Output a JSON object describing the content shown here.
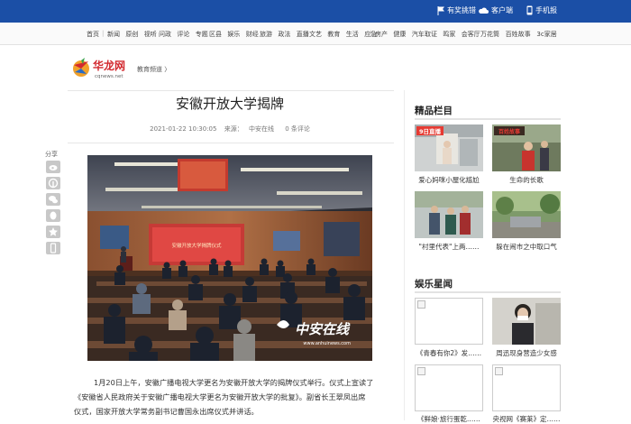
{
  "topbar": {
    "link1": "有奖挑错",
    "link2": "客户端",
    "link3": "手机报"
  },
  "nav": {
    "g1": [
      "首页"
    ],
    "g2": [
      "新闻",
      "原创",
      "视听"
    ],
    "g3": [
      "问政",
      "评论",
      "专题"
    ],
    "g4": [
      "区县",
      "娱乐",
      "财经"
    ],
    "g5": [
      "旅游",
      "政法",
      "直播"
    ],
    "g6": [
      "文艺",
      "教育",
      "生活",
      "应急"
    ],
    "g7": [
      "房产",
      "健康",
      "汽车"
    ],
    "g8": [
      "取证",
      "鸣家",
      "会客厅"
    ],
    "g9": [
      "万花筒",
      "百姓故事",
      "3c家居"
    ]
  },
  "logo": {
    "main": "华龙网",
    "sub": "cqnews.net"
  },
  "breadcrumb": "教育频道 〉",
  "article": {
    "title": "安徽开放大学揭牌",
    "date": "2021-01-22 10:30:05",
    "source_label": "来源：",
    "source": "中安在线",
    "comments": "0 条评论",
    "watermark": "中安在线",
    "watermark_url": "www.anhuinews.com",
    "screen_text": "安徽开放大学揭牌仪式",
    "para_lines": [
      "1月20日上午，安徽广播电视大学更名为安徽开放大学的揭牌仪式举行。仪式上宣读了",
      "《安徽省人民政府关于安徽广播电视大学更名为安徽开放大学的批复》。副省长王翠凤出席",
      "仪式，国家开放大学常务副书记曹国永出席仪式并讲话。"
    ]
  },
  "share": {
    "label": "分享",
    "icons": [
      "weibo-icon",
      "pinterest-icon",
      "wechat-icon",
      "qq-icon",
      "star-icon",
      "mobile-icon"
    ]
  },
  "sidebar": {
    "section1": {
      "title": "精品栏目",
      "items": [
        {
          "caption": "爱心妈咪小屋化尴尬",
          "badge": "9日直播"
        },
        {
          "caption": "生命的长歌",
          "badge": "百姓故事"
        },
        {
          "caption": "\"村里代表\"上两……"
        },
        {
          "caption": "躲在闹市之中取口气"
        }
      ]
    },
    "section2": {
      "title": "娱乐星闻",
      "items": [
        {
          "caption": "《青春有你2》发……"
        },
        {
          "caption": "周迅现身营造少女感"
        },
        {
          "caption": "《鲜娘·旅行蛋乾……"
        },
        {
          "caption": "央视网《赛莱》定……"
        }
      ]
    }
  },
  "colors": {
    "topbar": "#1b4fa6",
    "logo_red": "#d2282e"
  }
}
